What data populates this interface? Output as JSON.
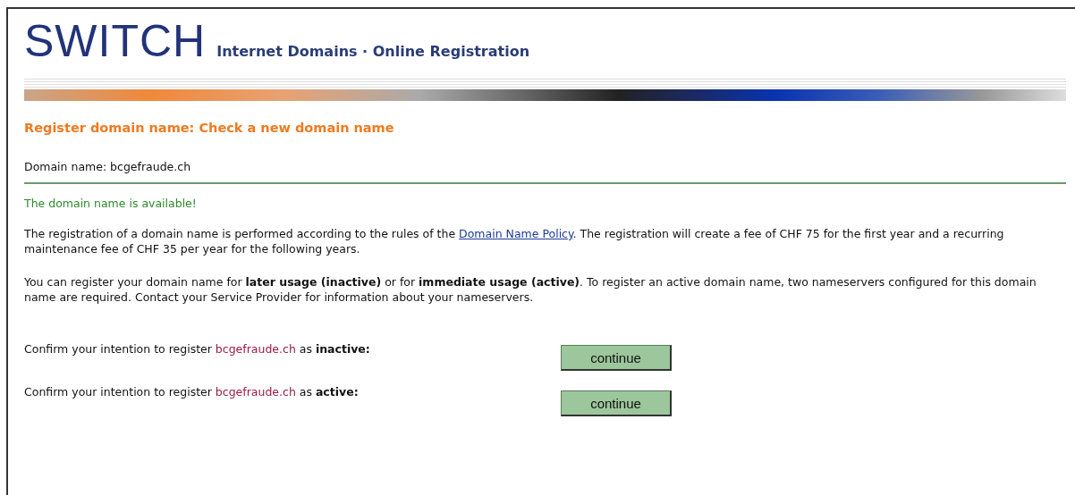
{
  "header": {
    "logo": "SWITCH",
    "subtitle": "Internet Domains · Online Registration"
  },
  "heading": "Register domain name: Check a new domain name",
  "domain_line": "Domain name: bcgefraude.ch",
  "status": "The domain name is available!",
  "paragraph_1": {
    "before": "The registration of a domain name is performed according to the rules of the ",
    "link": "Domain Name Policy",
    "after": ". The registration will create a fee of CHF 75 for the first year and a recurring maintenance fee of CHF 35 per year for the following years."
  },
  "paragraph_2": "You can register your domain name for **later usage (inactive)** or for **immediate usage (active)**. To register an active domain name, two nameservers configured for this domain name are required. Contact your Service Provider for information about your nameservers.",
  "confirmations": [
    {
      "prefix": "Confirm your intention to register ",
      "domain": "bcgefraude.ch",
      "suffix": " as **inactive:**",
      "button": "continue"
    },
    {
      "prefix": "Confirm your intention to register ",
      "domain": "bcgefraude.ch",
      "suffix": " as **active:**",
      "button": "continue"
    }
  ]
}
